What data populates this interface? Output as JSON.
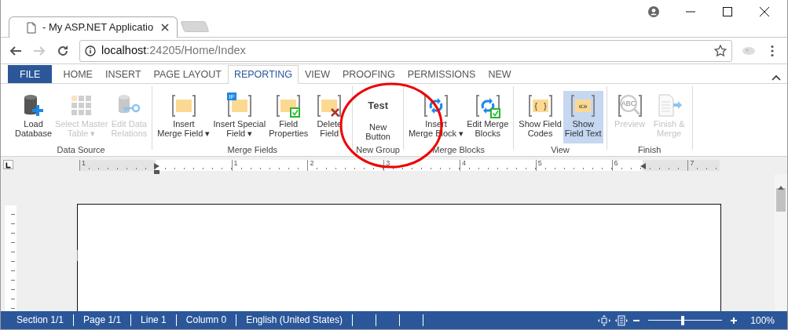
{
  "browser": {
    "tab_title": "- My ASP.NET Applicatio",
    "url_host": "localhost",
    "url_rest": ":24205/Home/Index"
  },
  "ribbon_tabs": [
    {
      "label": "FILE",
      "kind": "file",
      "selected": false
    },
    {
      "label": "HOME",
      "kind": "tab",
      "selected": false
    },
    {
      "label": "INSERT",
      "kind": "tab",
      "selected": false
    },
    {
      "label": "PAGE LAYOUT",
      "kind": "tab",
      "selected": false
    },
    {
      "label": "REPORTING",
      "kind": "tab",
      "selected": true
    },
    {
      "label": "VIEW",
      "kind": "tab",
      "selected": false
    },
    {
      "label": "PROOFING",
      "kind": "tab",
      "selected": false
    },
    {
      "label": "PERMISSIONS",
      "kind": "tab",
      "selected": false
    },
    {
      "label": "NEW",
      "kind": "tab",
      "selected": false
    }
  ],
  "ribbon_groups": [
    {
      "label": "Data Source",
      "buttons": [
        {
          "lines": [
            "Load",
            "Database"
          ],
          "disabled": false,
          "selected": false
        },
        {
          "lines": [
            "Select Master",
            "Table ▾"
          ],
          "disabled": true,
          "selected": false
        },
        {
          "lines": [
            "Edit Data",
            "Relations"
          ],
          "disabled": true,
          "selected": false
        }
      ]
    },
    {
      "label": "Merge Fields",
      "buttons": [
        {
          "lines": [
            "Insert",
            "Merge Field ▾"
          ],
          "disabled": false,
          "selected": false
        },
        {
          "icon_text": "IF",
          "lines": [
            "Insert Special",
            "Field ▾"
          ],
          "disabled": false,
          "selected": false
        },
        {
          "lines": [
            "Field",
            "Properties"
          ],
          "disabled": false,
          "selected": false
        },
        {
          "lines": [
            "Delete",
            "Field"
          ],
          "disabled": false,
          "selected": false
        }
      ]
    },
    {
      "label": "New Group",
      "buttons": [
        {
          "icon_text": "Test",
          "lines": [
            "New",
            "Button"
          ],
          "disabled": false,
          "selected": false
        }
      ]
    },
    {
      "label": "Merge Blocks",
      "buttons": [
        {
          "lines": [
            "Insert",
            "Merge Block ▾"
          ],
          "disabled": false,
          "selected": false
        },
        {
          "lines": [
            "Edit Merge",
            "Blocks"
          ],
          "disabled": false,
          "selected": false
        }
      ]
    },
    {
      "label": "View",
      "buttons": [
        {
          "icon_text": "{   }",
          "lines": [
            "Show Field",
            "Codes"
          ],
          "disabled": false,
          "selected": false
        },
        {
          "icon_text": "«»",
          "lines": [
            "Show",
            "Field Text"
          ],
          "disabled": false,
          "selected": true
        }
      ]
    },
    {
      "label": "Finish",
      "buttons": [
        {
          "icon_text": "ABC",
          "lines": [
            "Preview"
          ],
          "disabled": true,
          "selected": false
        },
        {
          "lines": [
            "Finish &",
            "Merge"
          ],
          "disabled": true,
          "selected": false
        }
      ]
    }
  ],
  "ruler": {
    "numbers": [
      "1",
      "1",
      "2",
      "3",
      "4",
      "5",
      "6",
      "7"
    ]
  },
  "status_bar": {
    "items": [
      "Section 1/1",
      "Page 1/1",
      "Line 1",
      "Column 0",
      "English (United States)"
    ],
    "zoom": {
      "level": 0.47,
      "reading": "100%"
    }
  }
}
